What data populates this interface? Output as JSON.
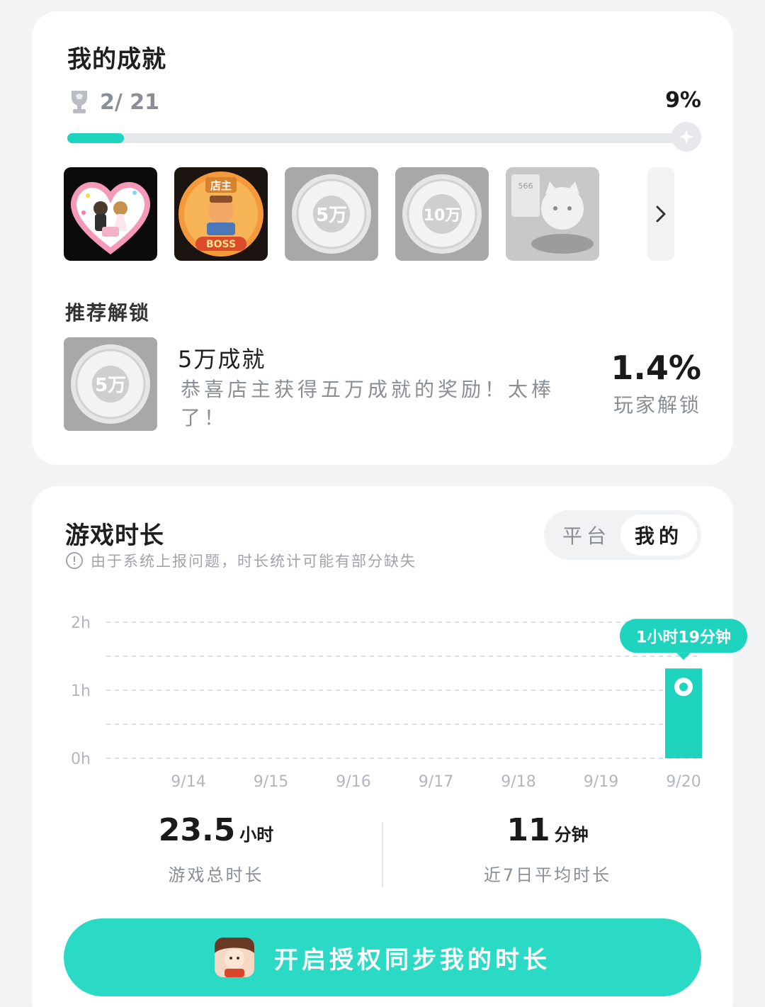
{
  "achievements": {
    "title": "我的成就",
    "count": "2/ 21",
    "percent": "9%",
    "progress_fraction": 0.09,
    "badges": [
      {
        "name": "wedding-badge",
        "unlocked": true
      },
      {
        "name": "boss-shop-badge",
        "unlocked": true,
        "text_top": "店主",
        "text_bottom": "BOSS"
      },
      {
        "name": "50k-badge",
        "unlocked": false,
        "text": "5万"
      },
      {
        "name": "100k-badge",
        "unlocked": false,
        "text": "10万"
      },
      {
        "name": "cat-food-badge",
        "unlocked": false,
        "text": "566"
      }
    ],
    "recommend_label": "推荐解锁",
    "recommend": {
      "name": "5万成就",
      "description": "恭喜店主获得五万成就的奖励！太棒了！",
      "badge_text": "5万",
      "percent": "1.4%",
      "percent_label": "玩家解锁"
    }
  },
  "playtime": {
    "title": "游戏时长",
    "toggle": {
      "inactive": "平台",
      "active": "我的"
    },
    "notice": "由于系统上报问题，时长统计可能有部分缺失",
    "total": {
      "value": "23.5",
      "unit": "小时",
      "label": "游戏总时长"
    },
    "average": {
      "value": "11",
      "unit": "分钟",
      "label": "近7日平均时长"
    },
    "cta_label": "开启授权同步我的时长"
  },
  "chart_data": {
    "type": "bar",
    "categories": [
      "9/14",
      "9/15",
      "9/16",
      "9/17",
      "9/18",
      "9/19",
      "9/20"
    ],
    "values": [
      0,
      0,
      0,
      0,
      0,
      0,
      1.32
    ],
    "y_ticks": [
      "0h",
      "1h",
      "2h"
    ],
    "ylim": [
      0,
      2
    ],
    "tooltip": {
      "category": "9/20",
      "text": "1小时19分钟"
    },
    "grid": true,
    "color": "#1ed4bf"
  },
  "colors": {
    "accent": "#1ed4bf",
    "cta": "#2bdac4",
    "muted_text": "#8a8f96"
  }
}
